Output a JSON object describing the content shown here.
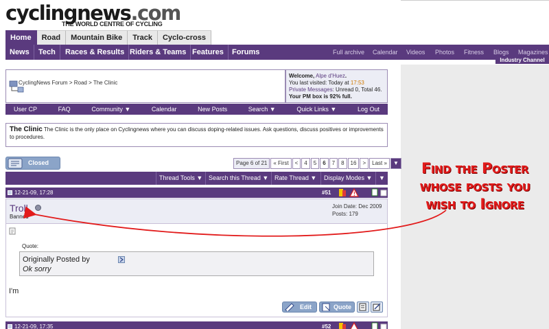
{
  "header": {
    "logo_main": "cyclingnews",
    "logo_domain": ".com",
    "tagline": "THE WORLD CENTRE OF CYCLING"
  },
  "tabs1": [
    {
      "label": "Home",
      "active": true
    },
    {
      "label": "Road"
    },
    {
      "label": "Mountain Bike"
    },
    {
      "label": "Track"
    },
    {
      "label": "Cyclo-cross"
    }
  ],
  "nav": {
    "left": [
      "News",
      "Tech",
      "Races & Results",
      "Riders & Teams",
      "Features",
      "Forums"
    ],
    "right": [
      "Full archive",
      "Calendar",
      "Videos",
      "Photos",
      "Fitness",
      "Blogs",
      "Magazines"
    ],
    "industry": "Industry Channel"
  },
  "breadcrumb": {
    "forum": "CyclingNews Forum",
    "sep": ">",
    "road": "Road",
    "clinic": "The Clinic"
  },
  "welcome": {
    "greeting": "Welcome,",
    "user": "Alpe d'Huez",
    "last_visit_prefix": "You last visited: Today at ",
    "last_visit_time": "17:53",
    "pm_link": "Private Messages",
    "pm_info": ": Unread 0, Total 46.",
    "pm_box": "Your PM box is 92% full."
  },
  "forumnav": [
    "User CP",
    "FAQ",
    "Community ▼",
    "Calendar",
    "New Posts",
    "Search ▼",
    "Quick Links ▼",
    "Log Out"
  ],
  "clinic": {
    "title": "The Clinic",
    "desc": "The Clinic is the only place on Cyclingnews where you can discuss doping-related issues. Ask questions, discuss positives or improvements to procedures."
  },
  "closed_label": "Closed",
  "pager": {
    "label": "Page 6 of 21",
    "items": [
      "« First",
      "<",
      "4",
      "5",
      "6",
      "7",
      "8",
      "16",
      ">",
      "Last »"
    ],
    "current": "6"
  },
  "tools": [
    "Thread Tools ▼",
    "Search this Thread ▼",
    "Rate Thread ▼",
    "Display Modes ▼"
  ],
  "post": {
    "date": "12-21-09, 17:28",
    "number": "#51",
    "username": "Troll",
    "rank": "Banned",
    "join_date": "Join Date: Dec 2009",
    "posts": "Posts: 179",
    "quote_label": "Quote:",
    "originally": "Originally Posted by",
    "quote_text": "Ok sorry",
    "body": "I'm",
    "edit_label": "Edit",
    "quote_btn_label": "Quote"
  },
  "post2": {
    "date": "12-21-09, 17:35",
    "number": "#52"
  },
  "callout": {
    "line1": "Find the Poster",
    "line2": "whose posts you",
    "line3": "wish to Ignore",
    "color": "#e21b1b"
  },
  "colors": {
    "brand_purple": "#5a3a7e",
    "light_purple_bg": "#ecedf5",
    "button_blue": "#8ba4c8"
  }
}
